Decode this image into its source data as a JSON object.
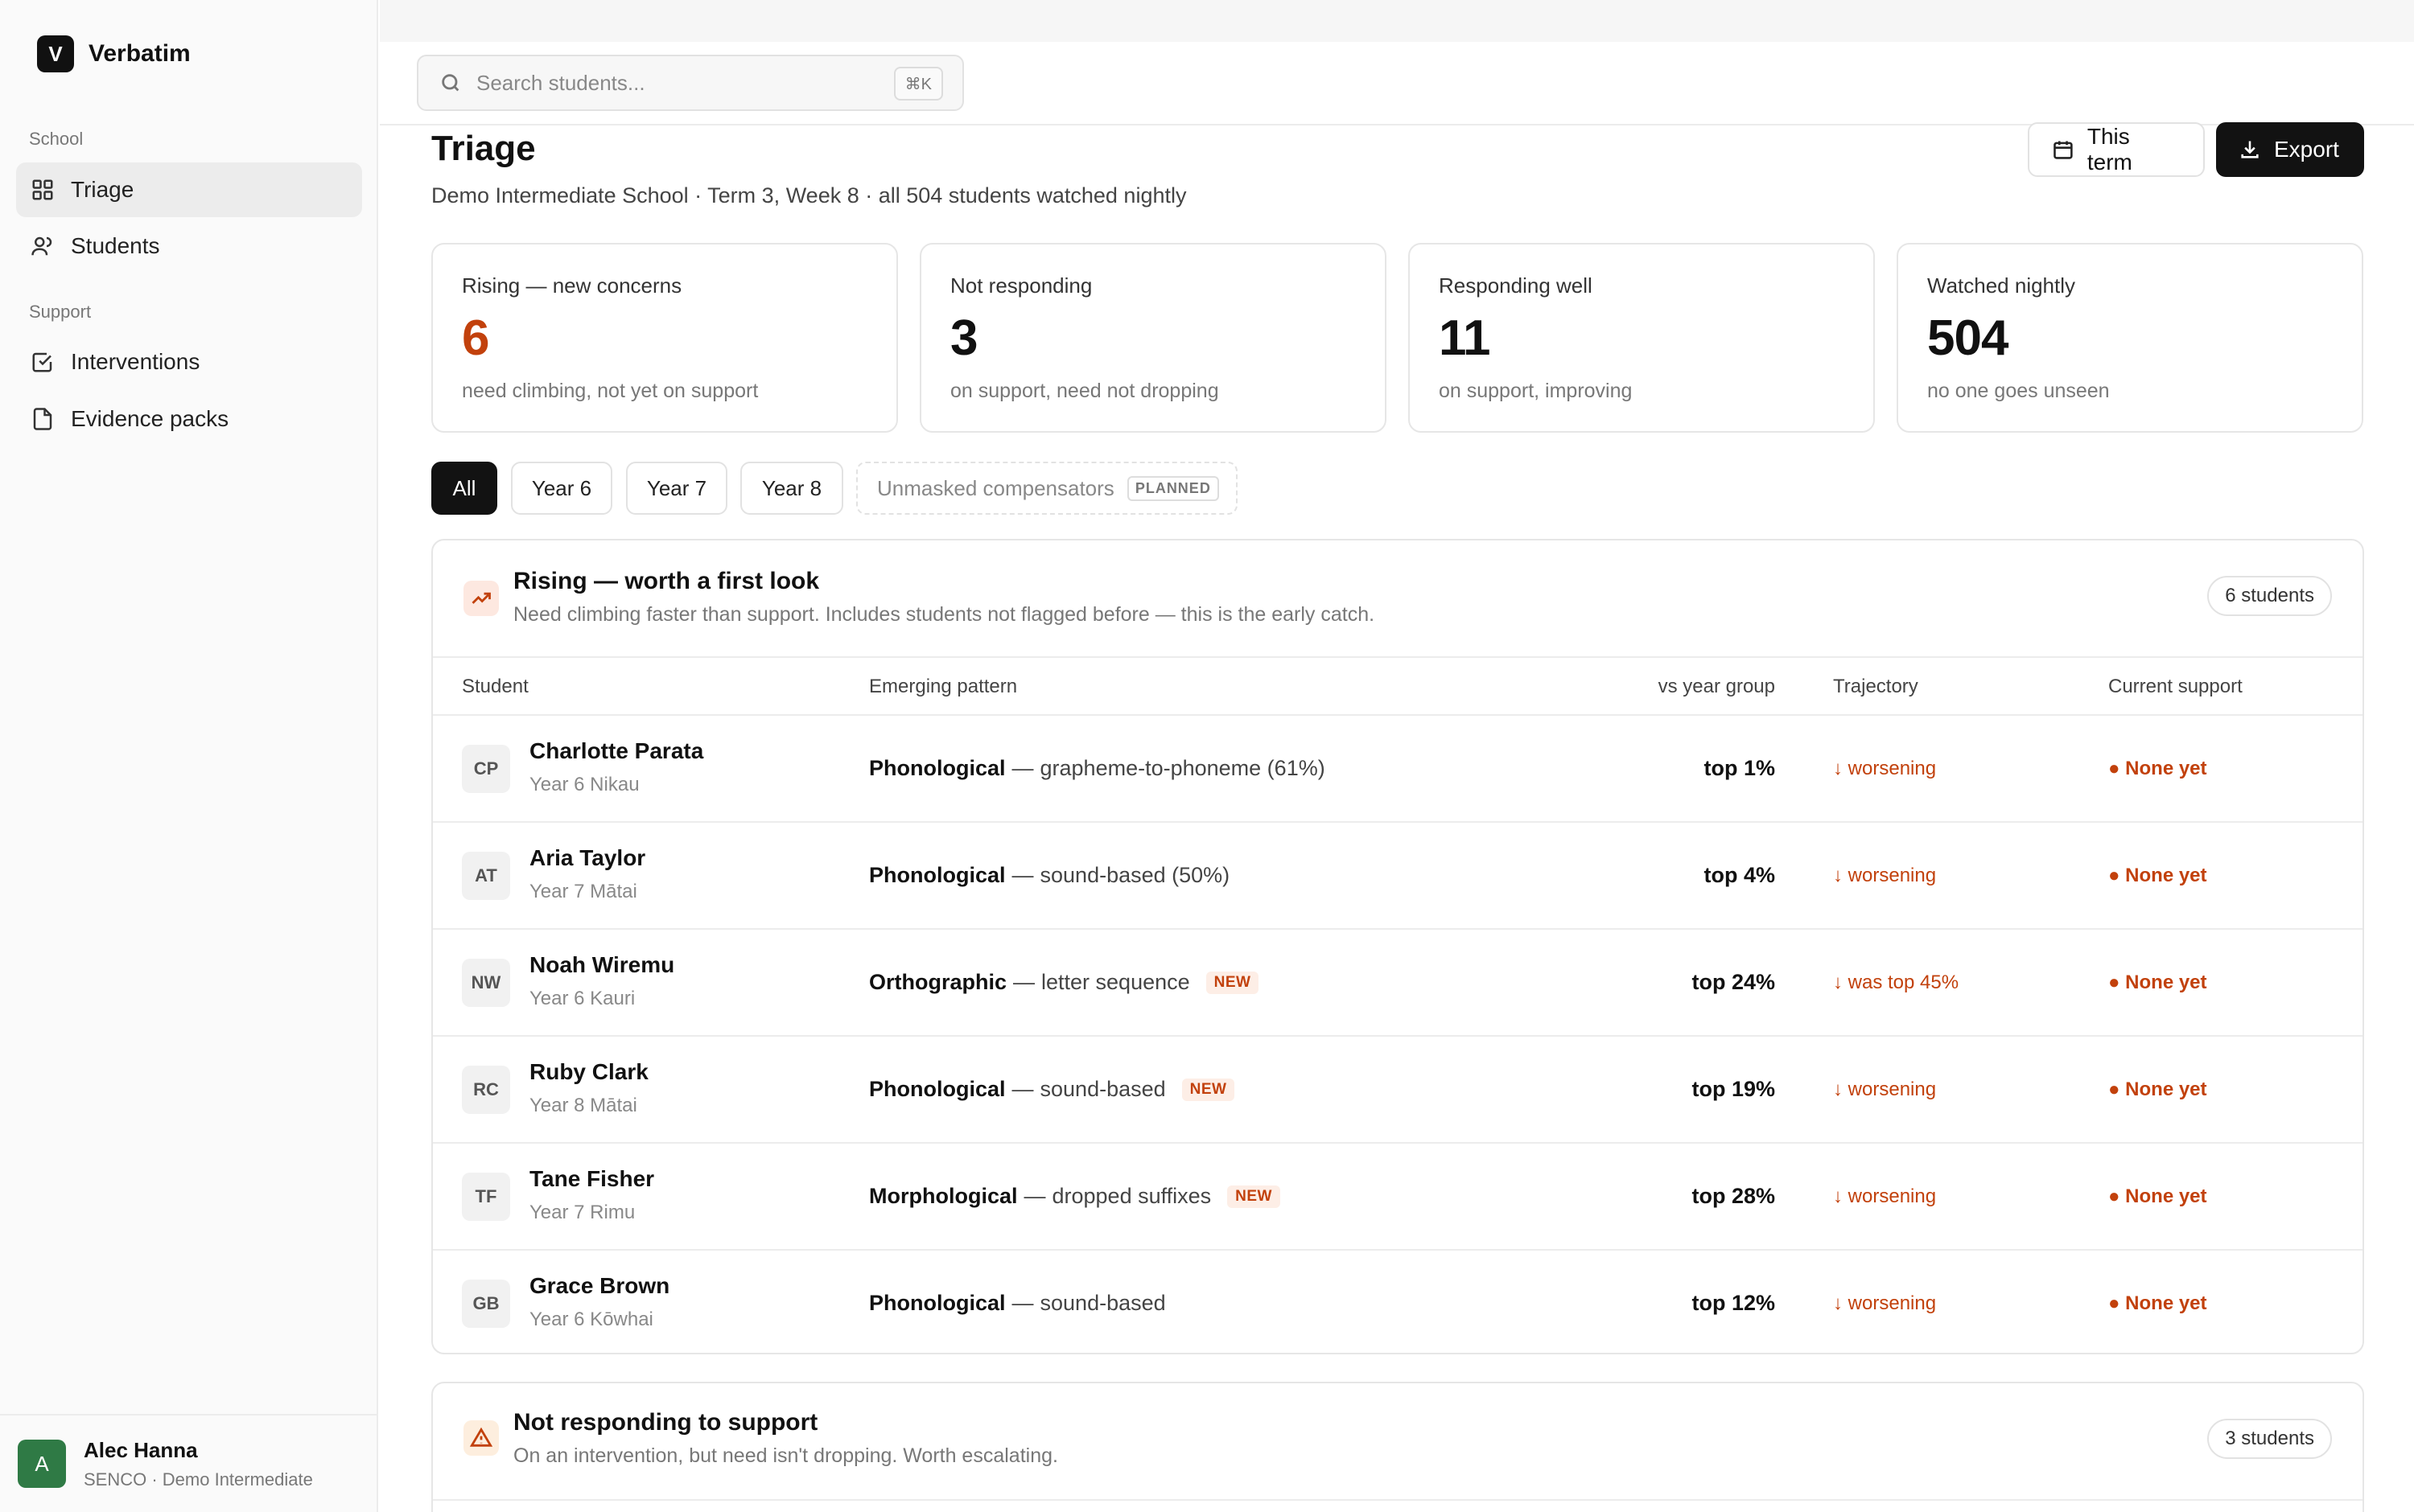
{
  "brand": {
    "logo_letter": "V",
    "name": "Verbatim"
  },
  "sidebar": {
    "section_school": "School",
    "section_support": "Support",
    "items": [
      {
        "label": "Triage",
        "icon": "grid-icon",
        "active": true
      },
      {
        "label": "Students",
        "icon": "users-icon",
        "active": false
      },
      {
        "label": "Interventions",
        "icon": "checkbox-icon",
        "active": false
      },
      {
        "label": "Evidence packs",
        "icon": "file-icon",
        "active": false
      }
    ],
    "user": {
      "initial": "A",
      "name": "Alec Hanna",
      "role": "SENCO · Demo Intermediate"
    }
  },
  "search": {
    "placeholder": "Search students...",
    "shortcut": "⌘K"
  },
  "page": {
    "title": "Triage",
    "subtitle": "Demo Intermediate School · Term 3, Week 8 · all 504 students watched nightly",
    "term_button": "This term",
    "export_button": "Export"
  },
  "stats": [
    {
      "label": "Rising — new concerns",
      "value": "6",
      "desc": "need climbing, not yet on support",
      "accent": "#c2410c"
    },
    {
      "label": "Not responding",
      "value": "3",
      "desc": "on support, need not dropping"
    },
    {
      "label": "Responding well",
      "value": "11",
      "desc": "on support, improving"
    },
    {
      "label": "Watched nightly",
      "value": "504",
      "desc": "no one goes unseen"
    }
  ],
  "filters": {
    "chips": [
      "All",
      "Year 6",
      "Year 7",
      "Year 8"
    ],
    "planned_chip": "Unmasked compensators",
    "planned_badge": "PLANNED",
    "active": "All"
  },
  "rising": {
    "title": "Rising — worth a first look",
    "desc": "Need climbing faster than support. Includes students not flagged before — this is the early catch.",
    "count": "6 students",
    "columns": {
      "student": "Student",
      "pattern": "Emerging pattern",
      "vs": "vs year group",
      "trajectory": "Trajectory",
      "support": "Current support"
    },
    "rows": [
      {
        "initials": "CP",
        "name": "Charlotte Parata",
        "year": "Year 6 Nikau",
        "pattern_type": "Phonological",
        "pattern_detail": "grapheme-to-phoneme (61%)",
        "new": "",
        "vs": "top 1%",
        "trajectory": "↓ worsening",
        "support": "● None yet"
      },
      {
        "initials": "AT",
        "name": "Aria Taylor",
        "year": "Year 7 Mātai",
        "pattern_type": "Phonological",
        "pattern_detail": "sound-based (50%)",
        "new": "",
        "vs": "top 4%",
        "trajectory": "↓ worsening",
        "support": "● None yet"
      },
      {
        "initials": "NW",
        "name": "Noah Wiremu",
        "year": "Year 6 Kauri",
        "pattern_type": "Orthographic",
        "pattern_detail": "letter sequence",
        "new": "NEW",
        "vs": "top 24%",
        "trajectory": "↓ was top 45%",
        "support": "● None yet"
      },
      {
        "initials": "RC",
        "name": "Ruby Clark",
        "year": "Year 8 Mātai",
        "pattern_type": "Phonological",
        "pattern_detail": "sound-based",
        "new": "NEW",
        "vs": "top 19%",
        "trajectory": "↓ worsening",
        "support": "● None yet"
      },
      {
        "initials": "TF",
        "name": "Tane Fisher",
        "year": "Year 7 Rimu",
        "pattern_type": "Morphological",
        "pattern_detail": "dropped suffixes",
        "new": "NEW",
        "vs": "top 28%",
        "trajectory": "↓ worsening",
        "support": "● None yet"
      },
      {
        "initials": "GB",
        "name": "Grace Brown",
        "year": "Year 6 Kōwhai",
        "pattern_type": "Phonological",
        "pattern_detail": "sound-based",
        "new": "",
        "vs": "top 12%",
        "trajectory": "↓ worsening",
        "support": "● None yet"
      }
    ]
  },
  "not_responding": {
    "title": "Not responding to support",
    "desc": "On an intervention, but need isn't dropping. Worth escalating.",
    "count": "3 students"
  },
  "colors": {
    "accent": "#c2410c",
    "dark": "#121212",
    "avatar_green": "#2f7a45"
  }
}
